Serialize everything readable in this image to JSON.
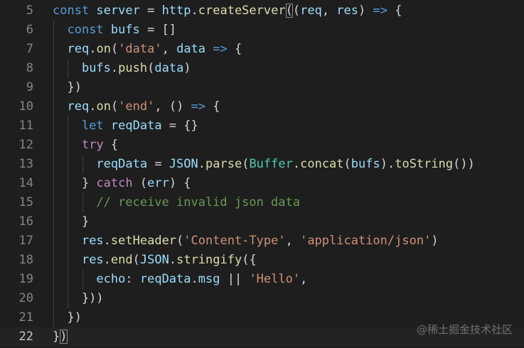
{
  "watermark": "@稀土掘金技术社区",
  "lines": [
    {
      "num": "5",
      "tokens": [
        {
          "t": "const ",
          "c": "kw"
        },
        {
          "t": "server",
          "c": "var"
        },
        {
          "t": " = ",
          "c": "punc"
        },
        {
          "t": "http",
          "c": "var"
        },
        {
          "t": ".",
          "c": "punc"
        },
        {
          "t": "createServer",
          "c": "fn"
        },
        {
          "t": "(",
          "c": "bm"
        },
        {
          "t": "(",
          "c": "punc"
        },
        {
          "t": "req",
          "c": "var"
        },
        {
          "t": ", ",
          "c": "punc"
        },
        {
          "t": "res",
          "c": "var"
        },
        {
          "t": ") ",
          "c": "punc"
        },
        {
          "t": "=>",
          "c": "kw"
        },
        {
          "t": " {",
          "c": "punc"
        }
      ]
    },
    {
      "num": "6",
      "tokens": [
        {
          "t": "  ",
          "c": "punc"
        },
        {
          "t": "const ",
          "c": "kw"
        },
        {
          "t": "bufs",
          "c": "var"
        },
        {
          "t": " = []",
          "c": "punc"
        }
      ]
    },
    {
      "num": "7",
      "tokens": [
        {
          "t": "  ",
          "c": "punc"
        },
        {
          "t": "req",
          "c": "var"
        },
        {
          "t": ".",
          "c": "punc"
        },
        {
          "t": "on",
          "c": "fn"
        },
        {
          "t": "(",
          "c": "punc"
        },
        {
          "t": "'data'",
          "c": "str"
        },
        {
          "t": ", ",
          "c": "punc"
        },
        {
          "t": "data",
          "c": "var"
        },
        {
          "t": " ",
          "c": "punc"
        },
        {
          "t": "=>",
          "c": "kw"
        },
        {
          "t": " {",
          "c": "punc"
        }
      ]
    },
    {
      "num": "8",
      "tokens": [
        {
          "t": "    ",
          "c": "punc"
        },
        {
          "t": "bufs",
          "c": "var"
        },
        {
          "t": ".",
          "c": "punc"
        },
        {
          "t": "push",
          "c": "fn"
        },
        {
          "t": "(",
          "c": "punc"
        },
        {
          "t": "data",
          "c": "var"
        },
        {
          "t": ")",
          "c": "punc"
        }
      ]
    },
    {
      "num": "9",
      "tokens": [
        {
          "t": "  })",
          "c": "punc"
        }
      ]
    },
    {
      "num": "10",
      "tokens": [
        {
          "t": "  ",
          "c": "punc"
        },
        {
          "t": "req",
          "c": "var"
        },
        {
          "t": ".",
          "c": "punc"
        },
        {
          "t": "on",
          "c": "fn"
        },
        {
          "t": "(",
          "c": "punc"
        },
        {
          "t": "'end'",
          "c": "str"
        },
        {
          "t": ", () ",
          "c": "punc"
        },
        {
          "t": "=>",
          "c": "kw"
        },
        {
          "t": " {",
          "c": "punc"
        }
      ]
    },
    {
      "num": "11",
      "tokens": [
        {
          "t": "    ",
          "c": "punc"
        },
        {
          "t": "let ",
          "c": "kw"
        },
        {
          "t": "reqData",
          "c": "var"
        },
        {
          "t": " = {}",
          "c": "punc"
        }
      ]
    },
    {
      "num": "12",
      "tokens": [
        {
          "t": "    ",
          "c": "punc"
        },
        {
          "t": "try",
          "c": "ctl"
        },
        {
          "t": " {",
          "c": "punc"
        }
      ]
    },
    {
      "num": "13",
      "tokens": [
        {
          "t": "      ",
          "c": "punc"
        },
        {
          "t": "reqData",
          "c": "var"
        },
        {
          "t": " = ",
          "c": "punc"
        },
        {
          "t": "JSON",
          "c": "var"
        },
        {
          "t": ".",
          "c": "punc"
        },
        {
          "t": "parse",
          "c": "fn"
        },
        {
          "t": "(",
          "c": "punc"
        },
        {
          "t": "Buffer",
          "c": "type"
        },
        {
          "t": ".",
          "c": "punc"
        },
        {
          "t": "concat",
          "c": "fn"
        },
        {
          "t": "(",
          "c": "punc"
        },
        {
          "t": "bufs",
          "c": "var"
        },
        {
          "t": ").",
          "c": "punc"
        },
        {
          "t": "toString",
          "c": "fn"
        },
        {
          "t": "())",
          "c": "punc"
        }
      ]
    },
    {
      "num": "14",
      "tokens": [
        {
          "t": "    } ",
          "c": "punc"
        },
        {
          "t": "catch",
          "c": "ctl"
        },
        {
          "t": " (",
          "c": "punc"
        },
        {
          "t": "err",
          "c": "var"
        },
        {
          "t": ") {",
          "c": "punc"
        }
      ]
    },
    {
      "num": "15",
      "tokens": [
        {
          "t": "      ",
          "c": "punc"
        },
        {
          "t": "// receive invalid json data",
          "c": "com"
        }
      ]
    },
    {
      "num": "16",
      "tokens": [
        {
          "t": "    }",
          "c": "punc"
        }
      ]
    },
    {
      "num": "17",
      "tokens": [
        {
          "t": "    ",
          "c": "punc"
        },
        {
          "t": "res",
          "c": "var"
        },
        {
          "t": ".",
          "c": "punc"
        },
        {
          "t": "setHeader",
          "c": "fn"
        },
        {
          "t": "(",
          "c": "punc"
        },
        {
          "t": "'Content-Type'",
          "c": "str"
        },
        {
          "t": ", ",
          "c": "punc"
        },
        {
          "t": "'application/json'",
          "c": "str"
        },
        {
          "t": ")",
          "c": "punc"
        }
      ]
    },
    {
      "num": "18",
      "tokens": [
        {
          "t": "    ",
          "c": "punc"
        },
        {
          "t": "res",
          "c": "var"
        },
        {
          "t": ".",
          "c": "punc"
        },
        {
          "t": "end",
          "c": "fn"
        },
        {
          "t": "(",
          "c": "punc"
        },
        {
          "t": "JSON",
          "c": "var"
        },
        {
          "t": ".",
          "c": "punc"
        },
        {
          "t": "stringify",
          "c": "fn"
        },
        {
          "t": "({",
          "c": "punc"
        }
      ]
    },
    {
      "num": "19",
      "tokens": [
        {
          "t": "      ",
          "c": "punc"
        },
        {
          "t": "echo",
          "c": "var"
        },
        {
          "t": ": ",
          "c": "punc"
        },
        {
          "t": "reqData",
          "c": "var"
        },
        {
          "t": ".",
          "c": "punc"
        },
        {
          "t": "msg",
          "c": "var"
        },
        {
          "t": " || ",
          "c": "punc"
        },
        {
          "t": "'Hello'",
          "c": "str"
        },
        {
          "t": ",",
          "c": "punc"
        }
      ]
    },
    {
      "num": "20",
      "tokens": [
        {
          "t": "    }))",
          "c": "punc"
        }
      ]
    },
    {
      "num": "21",
      "tokens": [
        {
          "t": "  })",
          "c": "punc"
        }
      ]
    },
    {
      "num": "22",
      "current": true,
      "tokens": [
        {
          "t": "}",
          "c": "punc"
        },
        {
          "t": ")",
          "c": "bm"
        }
      ]
    }
  ],
  "colors": {
    "background": "#1e1e1e",
    "keyword": "#569cd6",
    "control": "#c586c0",
    "function": "#dcdcaa",
    "variable": "#9cdcfe",
    "type": "#4ec9b0",
    "string": "#ce9178",
    "comment": "#6a9955"
  }
}
